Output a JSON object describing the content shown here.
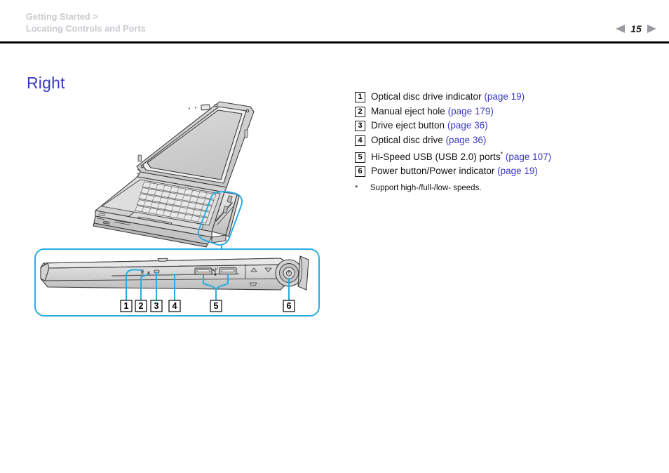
{
  "header": {
    "breadcrumb_line1": "Getting Started >",
    "breadcrumb_line2": "Locating Controls and Ports",
    "page_number": "15",
    "prev_icon": "left-triangle-icon",
    "next_icon": "right-triangle-icon"
  },
  "section": {
    "title": "Right"
  },
  "legend": {
    "items": [
      {
        "num": "1",
        "label": "Optical disc drive indicator",
        "link": "(page 19)",
        "asterisk": ""
      },
      {
        "num": "2",
        "label": "Manual eject hole",
        "link": "(page 179)",
        "asterisk": ""
      },
      {
        "num": "3",
        "label": "Drive eject button",
        "link": "(page 36)",
        "asterisk": ""
      },
      {
        "num": "4",
        "label": "Optical disc drive",
        "link": "(page 36)",
        "asterisk": ""
      },
      {
        "num": "5",
        "label": "Hi-Speed USB (USB 2.0) ports",
        "link": "(page 107)",
        "asterisk": "*"
      },
      {
        "num": "6",
        "label": "Power button/Power indicator",
        "link": "(page 19)",
        "asterisk": ""
      }
    ],
    "footnote_mark": "*",
    "footnote_text": "Support high-/full-/low- speeds."
  },
  "illustration": {
    "alt": "VAIO laptop shown open at an angle with the right-hand side highlighted, plus an enlarged detail view of the right side edge",
    "callouts": [
      "1",
      "2",
      "3",
      "4",
      "5",
      "6"
    ],
    "accent_color": "#29ABE2",
    "line_color": "#3a3a3a",
    "body_fill": "#d8d8d8",
    "screen_fill": "#cfcfcf"
  }
}
